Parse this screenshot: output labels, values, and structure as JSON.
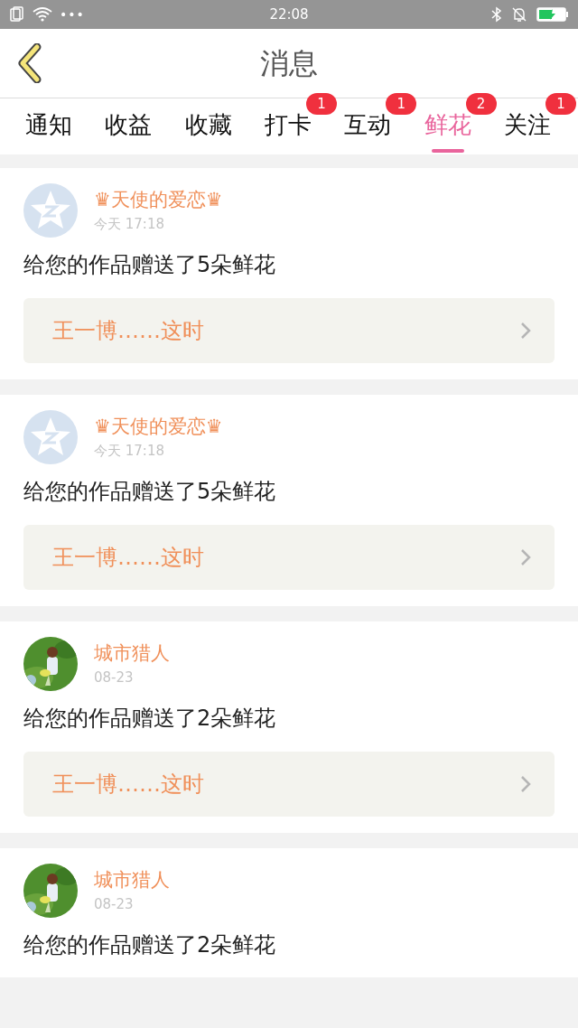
{
  "status_bar": {
    "time": "22:08",
    "dots": "•••"
  },
  "header": {
    "title": "消息"
  },
  "tabs": [
    {
      "label": "通知",
      "selected": false
    },
    {
      "label": "收益",
      "selected": false
    },
    {
      "label": "收藏",
      "selected": false
    },
    {
      "label": "打卡",
      "selected": false,
      "badge": "1"
    },
    {
      "label": "互动",
      "selected": false,
      "badge": "1"
    },
    {
      "label": "鲜花",
      "selected": true,
      "badge": "2"
    },
    {
      "label": "关注",
      "selected": false,
      "badge": "1"
    }
  ],
  "messages": [
    {
      "avatar": {
        "kind": "default"
      },
      "name": "♛天使的爱恋♛",
      "time": "今天 17:18",
      "text": "给您的作品赠送了5朵鲜花",
      "quote": "王一博……这时"
    },
    {
      "avatar": {
        "kind": "default"
      },
      "name": "♛天使的爱恋♛",
      "time": "今天 17:18",
      "text": "给您的作品赠送了5朵鲜花",
      "quote": "王一博……这时"
    },
    {
      "name": "城市猎人",
      "time": "08-23",
      "text": "给您的作品赠送了2朵鲜花",
      "quote": "王一博……这时"
    },
    {
      "name": "城市猎人",
      "time": "08-23",
      "text": "给您的作品赠送了2朵鲜花"
    }
  ]
}
